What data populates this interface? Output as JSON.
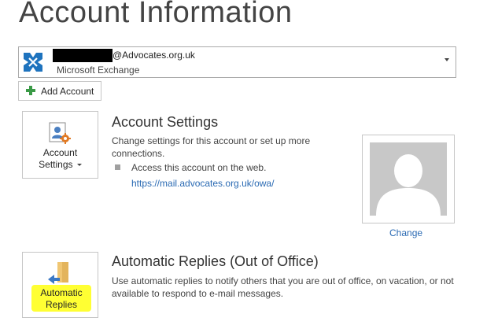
{
  "page": {
    "title": "Account Information"
  },
  "account": {
    "domain": "@Advocates.org.uk",
    "type": "Microsoft Exchange"
  },
  "add_account": {
    "label": "Add Account"
  },
  "account_settings": {
    "tile_label_line1": "Account",
    "tile_label_line2": "Settings",
    "title": "Account Settings",
    "description": "Change settings for this account or set up more connections.",
    "web_access": "Access this account on the web.",
    "owa_link": "https://mail.advocates.org.uk/owa/"
  },
  "profile_photo": {
    "change_label": "Change"
  },
  "automatic_replies": {
    "tile_label_line1": "Automatic",
    "tile_label_line2": "Replies",
    "title": "Automatic Replies (Out of Office)",
    "description": "Use automatic replies to notify others that you are out of office, on vacation, or not available to respond to e-mail messages."
  },
  "colors": {
    "link": "#2a6ab3",
    "highlight": "#ffff33",
    "add_green": "#3a9a46",
    "exchange_blue": "#1e73be"
  },
  "icons": {
    "exchange": "exchange-icon",
    "add": "plus-icon",
    "settings": "account-settings-icon",
    "replies": "automatic-replies-icon",
    "dropdown": "chevron-down-icon"
  }
}
